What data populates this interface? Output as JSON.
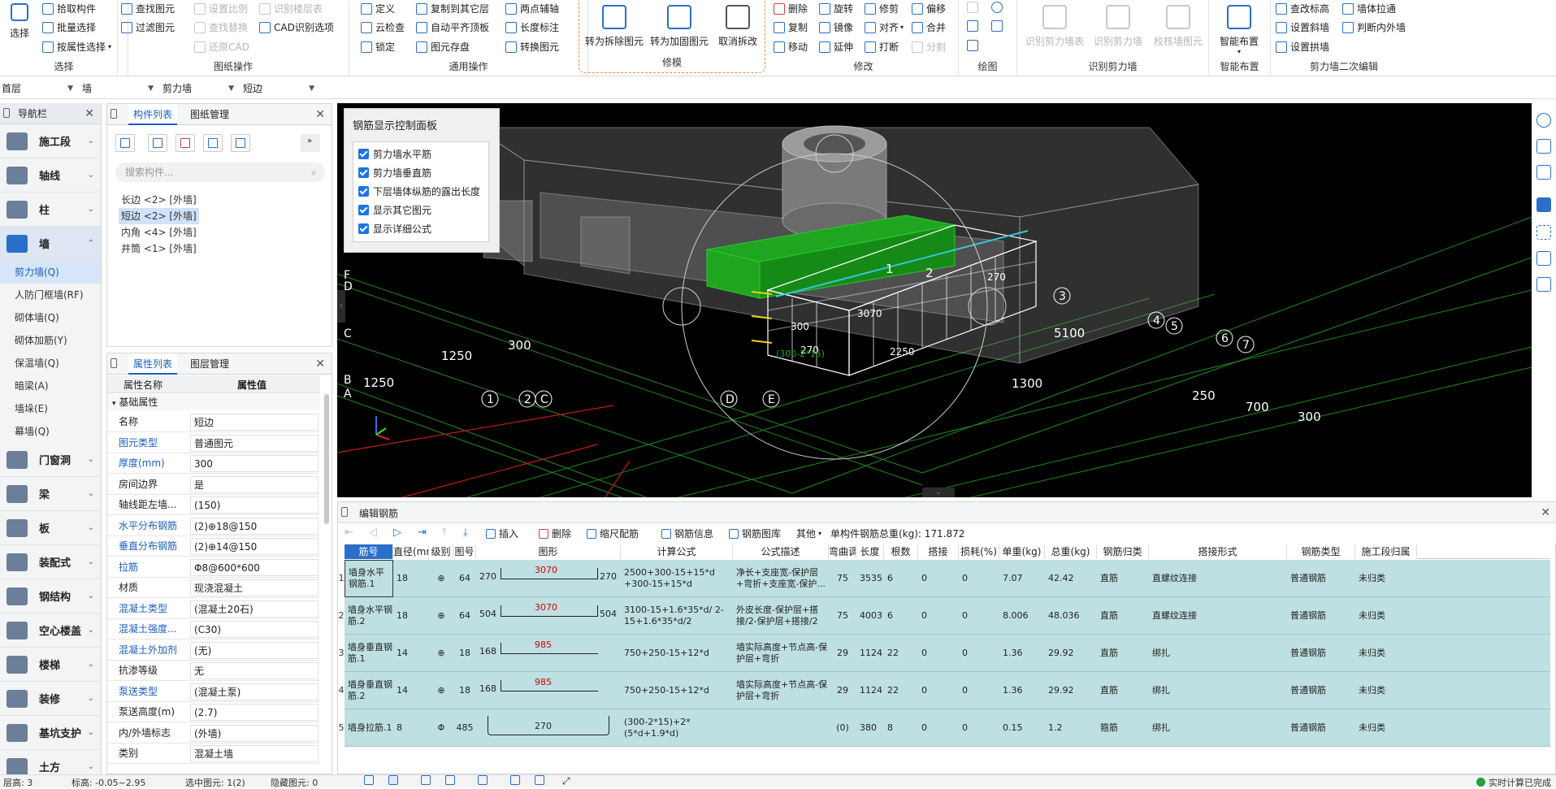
{
  "ribbon": {
    "groups": [
      {
        "title": "选择"
      },
      {
        "title": "图纸操作"
      },
      {
        "title": "通用操作"
      },
      {
        "title": "修模"
      },
      {
        "title": "修改"
      },
      {
        "title": "绘图"
      },
      {
        "title": "识别剪力墙"
      },
      {
        "title": "智能布置"
      },
      {
        "title": "剪力墙二次编辑"
      }
    ],
    "select_big": "选择",
    "select_items": [
      "拾取构件",
      "批量选择",
      "按属性选择"
    ],
    "drawing_items": [
      "查找图元",
      "过滤图元",
      "设置比例",
      "查找替换",
      "还原CAD",
      "识别楼层表",
      "CAD识别选项"
    ],
    "common_items": [
      "定义",
      "云检查",
      "锁定",
      "复制到其它层",
      "自动平齐顶板",
      "图元存盘",
      "两点辅轴",
      "长度标注",
      "转换图元"
    ],
    "repair_items": [
      "转为拆除图元",
      "转为加固图元",
      "取消拆改"
    ],
    "modify_items": [
      "删除",
      "复制",
      "移动",
      "旋转",
      "镜像",
      "延伸",
      "修剪",
      "对齐",
      "打断",
      "偏移",
      "合并",
      "分割"
    ],
    "recognize_items": [
      "识别剪力墙表",
      "识别剪力墙",
      "校核墙图元"
    ],
    "smart_items": [
      "智能布置"
    ],
    "wall2_items": [
      "查改标高",
      "设置斜墙",
      "设置拱墙",
      "墙体拉通",
      "判断内外墙"
    ]
  },
  "floorbar": {
    "floor": "首层",
    "type": "墙",
    "subtype": "剪力墙",
    "name": "短边"
  },
  "nav": {
    "title": "导航栏",
    "categories": [
      "施工段",
      "轴线",
      "柱",
      "墙",
      "门窗洞",
      "梁",
      "板",
      "装配式",
      "钢结构",
      "空心楼盖",
      "楼梯",
      "装修",
      "基坑支护",
      "土方"
    ],
    "wall_items": [
      "剪力墙(Q)",
      "人防门框墙(RF)",
      "砌体墙(Q)",
      "砌体加筋(Y)",
      "保温墙(Q)",
      "暗梁(A)",
      "墙垛(E)",
      "幕墙(Q)"
    ]
  },
  "complist": {
    "tabs": [
      "构件列表",
      "图纸管理"
    ],
    "search_placeholder": "搜索构件...",
    "items": [
      "长边 <2> [外墙]",
      "短边 <2> [外墙]",
      "内角 <4> [外墙]",
      "井筒 <1> [外墙]"
    ]
  },
  "proplist": {
    "tabs": [
      "属性列表",
      "图层管理"
    ],
    "col_name": "属性名称",
    "col_value": "属性值",
    "section": "基础属性",
    "rows": [
      {
        "k": "名称",
        "v": "短边"
      },
      {
        "k": "图元类型",
        "v": "普通图元"
      },
      {
        "k": "厚度(mm)",
        "v": "300"
      },
      {
        "k": "房间边界",
        "v": "是"
      },
      {
        "k": "轴线距左墙...",
        "v": "(150)"
      },
      {
        "k": "水平分布钢筋",
        "v": "(2)⊕18@150"
      },
      {
        "k": "垂直分布钢筋",
        "v": "(2)⊕14@150"
      },
      {
        "k": "拉筋",
        "v": "Φ8@600*600"
      },
      {
        "k": "材质",
        "v": "现浇混凝土"
      },
      {
        "k": "混凝土类型",
        "v": "(混凝土20石)"
      },
      {
        "k": "混凝土强度...",
        "v": "(C30)"
      },
      {
        "k": "混凝土外加剂",
        "v": "(无)"
      },
      {
        "k": "抗渗等级",
        "v": "无"
      },
      {
        "k": "泵送类型",
        "v": "(混凝土泵)"
      },
      {
        "k": "泵送高度(m)",
        "v": "(2.7)"
      },
      {
        "k": "内/外墙标志",
        "v": "(外墙)"
      },
      {
        "k": "类别",
        "v": "混凝土墙"
      }
    ]
  },
  "viewport": {
    "panel_title": "钢筋显示控制面板",
    "checks": [
      "剪力墙水平筋",
      "剪力墙垂直筋",
      "下层墙体纵筋的露出长度",
      "显示其它图元",
      "显示详细公式"
    ],
    "dims": [
      "300",
      "1250",
      "1250",
      "5100",
      "1300",
      "250",
      "700",
      "300",
      "3070",
      "2250",
      "300",
      "270",
      "270",
      "1",
      "2",
      "(300-2*15)"
    ],
    "axis_labels": [
      "F",
      "D",
      "C",
      "B",
      "A",
      "1",
      "2",
      "C",
      "D",
      "E",
      "3",
      "4",
      "5",
      "6",
      "7"
    ]
  },
  "editor": {
    "title": "编辑钢筋",
    "toolbar": [
      "插入",
      "删除",
      "缩尺配筋",
      "钢筋信息",
      "钢筋图库",
      "其他",
      "单构件钢筋总重(kg): 171.872"
    ],
    "headers": [
      "筋号",
      "直径(mm)",
      "级别",
      "图号",
      "图形",
      "计算公式",
      "公式描述",
      "弯曲调整",
      "长度",
      "根数",
      "搭接",
      "损耗(%)",
      "单重(kg)",
      "总重(kg)",
      "钢筋归类",
      "搭接形式",
      "钢筋类型",
      "施工段归属"
    ],
    "rows": [
      {
        "n": "1",
        "name": "墙身水平钢筋.1",
        "dia": "18",
        "grade": "⊕",
        "fig": "64",
        "sl": "270",
        "sm": "3070",
        "sr": "270",
        "formula": "2500+300-15+15*d +300-15+15*d",
        "desc": "净长+支座宽-保护层+弯折+支座宽-保护...",
        "bend": "75",
        "len": "3535",
        "cnt": "6",
        "lap": "0",
        "loss": "0",
        "uw": "7.07",
        "tw": "42.42",
        "cat": "直筋",
        "lapf": "直螺纹连接",
        "type": "普通钢筋",
        "seg": "未归类"
      },
      {
        "n": "2",
        "name": "墙身水平钢筋.2",
        "dia": "18",
        "grade": "⊕",
        "fig": "64",
        "sl": "504",
        "sm": "3070",
        "sr": "504",
        "formula": "3100-15+1.6*35*d/ 2-15+1.6*35*d/2",
        "desc": "外皮长度-保护层+搭接/2-保护层+搭接/2",
        "bend": "75",
        "len": "4003",
        "cnt": "6",
        "lap": "0",
        "loss": "0",
        "uw": "8.006",
        "tw": "48.036",
        "cat": "直筋",
        "lapf": "直螺纹连接",
        "type": "普通钢筋",
        "seg": "未归类"
      },
      {
        "n": "3",
        "name": "墙身垂直钢筋.1",
        "dia": "14",
        "grade": "⊕",
        "fig": "18",
        "sl": "168",
        "sm": "985",
        "sr": "",
        "formula": "750+250-15+12*d",
        "desc": "墙实际高度+节点高-保护层+弯折",
        "bend": "29",
        "len": "1124",
        "cnt": "22",
        "lap": "0",
        "loss": "0",
        "uw": "1.36",
        "tw": "29.92",
        "cat": "直筋",
        "lapf": "绑扎",
        "type": "普通钢筋",
        "seg": "未归类"
      },
      {
        "n": "4",
        "name": "墙身垂直钢筋.2",
        "dia": "14",
        "grade": "⊕",
        "fig": "18",
        "sl": "168",
        "sm": "985",
        "sr": "",
        "formula": "750+250-15+12*d",
        "desc": "墙实际高度+节点高-保护层+弯折",
        "bend": "29",
        "len": "1124",
        "cnt": "22",
        "lap": "0",
        "loss": "0",
        "uw": "1.36",
        "tw": "29.92",
        "cat": "直筋",
        "lapf": "绑扎",
        "type": "普通钢筋",
        "seg": "未归类"
      },
      {
        "n": "5",
        "name": "墙身拉筋.1",
        "dia": "8",
        "grade": "Φ",
        "fig": "485",
        "sl": "",
        "sm": "270",
        "sr": "",
        "formula": "(300-2*15)+2*(5*d+1.9*d)",
        "desc": "",
        "bend": "(0)",
        "len": "380",
        "cnt": "8",
        "lap": "0",
        "loss": "0",
        "uw": "0.15",
        "tw": "1.2",
        "cat": "箍筋",
        "lapf": "绑扎",
        "type": "普通钢筋",
        "seg": "未归类"
      }
    ]
  },
  "status": {
    "floor_height": "层高:  3",
    "elevation": "标高:  -0.05~2.95",
    "selected": "选中图元: 1(2)",
    "hidden": "隐藏图元: 0",
    "calc": "实时计算已完成"
  },
  "colors": {
    "accent": "#2a6fc9",
    "row_bg": "#bfe0e3",
    "dim_red": "#d20000",
    "rebar_green": "#1fa51f"
  }
}
